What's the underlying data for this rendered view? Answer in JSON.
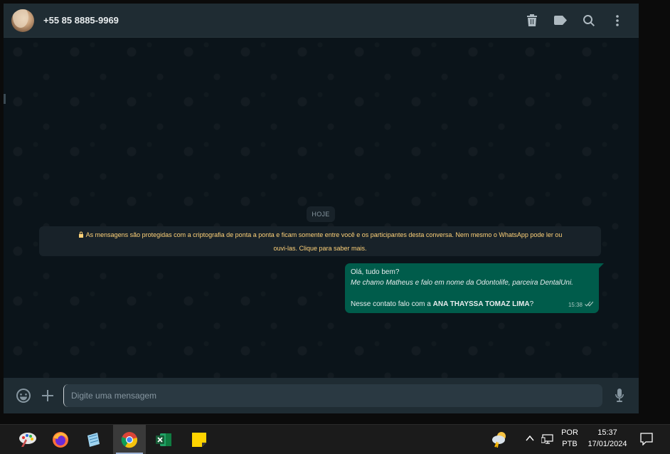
{
  "header": {
    "contact_name": "+55 85 8885-9969",
    "icons": [
      "delete-icon",
      "label-icon",
      "search-icon",
      "menu-icon"
    ]
  },
  "chat": {
    "date_chip": "HOJE",
    "encryption_notice_line1": "As mensagens são protegidas com a criptografia de ponta a ponta e ficam somente entre você e os participantes desta conversa. Nem mesmo o WhatsApp pode ler ou",
    "encryption_notice_line2": "ouvi-las. Clique para saber mais.",
    "message": {
      "line1": "Olá, tudo bem?",
      "line2": "Me chamo Matheus e falo em nome da Odontolife, parceira DentalUni.",
      "line3_prefix": "Nesse contato falo com a ",
      "line3_bold": "ANA THAYSSA TOMAZ LIMA",
      "line3_suffix": "?",
      "time": "15:38",
      "status": "delivered"
    }
  },
  "footer": {
    "input_placeholder": "Digite uma mensagem",
    "input_value": ""
  },
  "taskbar": {
    "apps": [
      "paint-app",
      "firefox",
      "notepad-app",
      "chrome",
      "excel",
      "sticky-notes"
    ],
    "active_app": "chrome",
    "language_line1": "POR",
    "language_line2": "PTB",
    "time": "15:37",
    "date": "17/01/2024"
  },
  "colors": {
    "header_bg": "#1f2c33",
    "chat_bg": "#0b141a",
    "bubble_out": "#005c4b",
    "notice_text": "#ffd279",
    "input_bg": "#2a3942"
  }
}
